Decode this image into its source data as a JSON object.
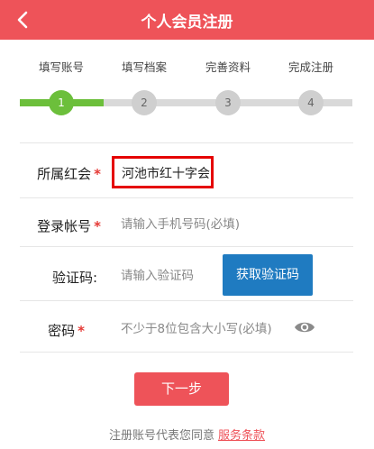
{
  "header": {
    "title": "个人会员注册",
    "back_label": "<"
  },
  "steps": [
    {
      "label": "填写账号",
      "number": "1",
      "status": "active"
    },
    {
      "label": "填写档案",
      "number": "2",
      "status": "pending"
    },
    {
      "label": "完善资料",
      "number": "3",
      "status": "pending"
    },
    {
      "label": "完成注册",
      "number": "4",
      "status": "pending"
    }
  ],
  "form": {
    "org": {
      "label": "所属红会",
      "required_mark": "*",
      "value": "河池市红十字会"
    },
    "account": {
      "label": "登录帐号",
      "required_mark": "*",
      "placeholder": "请输入手机号码(必填)"
    },
    "code": {
      "label": "验证码:",
      "placeholder": "请输入验证码",
      "button_label": "获取验证码"
    },
    "password": {
      "label": "密码",
      "required_mark": "*",
      "placeholder": "不少于8位包含大小写(必填)"
    }
  },
  "next_button": "下一步",
  "agreement": {
    "text": "注册账号代表您同意",
    "link": "服务条款"
  },
  "colors": {
    "primary_red": "#ee5359",
    "progress_green": "#6cbf3b",
    "button_blue": "#1f7bc1",
    "required_red": "#e53935",
    "highlight_border": "#e50000"
  }
}
